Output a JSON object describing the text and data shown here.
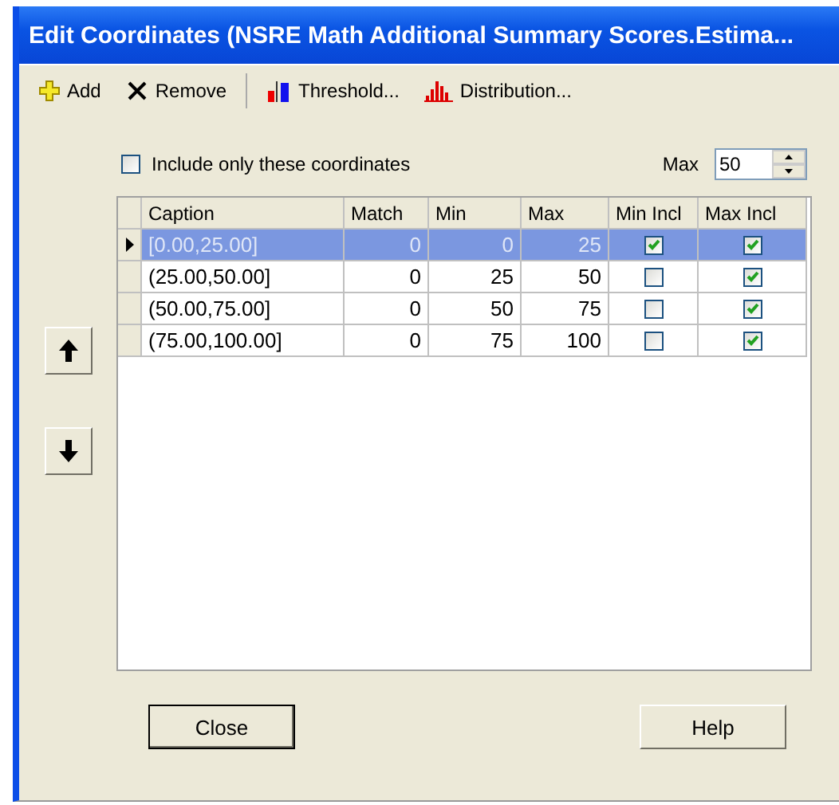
{
  "window": {
    "title": "Edit Coordinates (NSRE Math Additional Summary Scores.Estima..."
  },
  "toolbar": [
    {
      "kind": "add",
      "label": "Add"
    },
    {
      "kind": "remove",
      "label": "Remove"
    },
    {
      "kind": "threshold",
      "label": "Threshold..."
    },
    {
      "kind": "distribution",
      "label": "Distribution..."
    }
  ],
  "include_only": {
    "label": "Include only these coordinates",
    "checked": false
  },
  "max_field": {
    "label": "Max",
    "value": "50"
  },
  "table": {
    "columns": [
      "Caption",
      "Match",
      "Min",
      "Max",
      "Min Incl",
      "Max Incl"
    ],
    "rows": [
      {
        "selected": true,
        "caption": "[0.00,25.00]",
        "match": "0",
        "min": "0",
        "max": "25",
        "min_incl": true,
        "max_incl": true
      },
      {
        "selected": false,
        "caption": "(25.00,50.00]",
        "match": "0",
        "min": "25",
        "max": "50",
        "min_incl": false,
        "max_incl": true
      },
      {
        "selected": false,
        "caption": "(50.00,75.00]",
        "match": "0",
        "min": "50",
        "max": "75",
        "min_incl": false,
        "max_incl": true
      },
      {
        "selected": false,
        "caption": "(75.00,100.00]",
        "match": "0",
        "min": "75",
        "max": "100",
        "min_incl": false,
        "max_incl": true
      }
    ]
  },
  "buttons": [
    "Close",
    "Help"
  ]
}
